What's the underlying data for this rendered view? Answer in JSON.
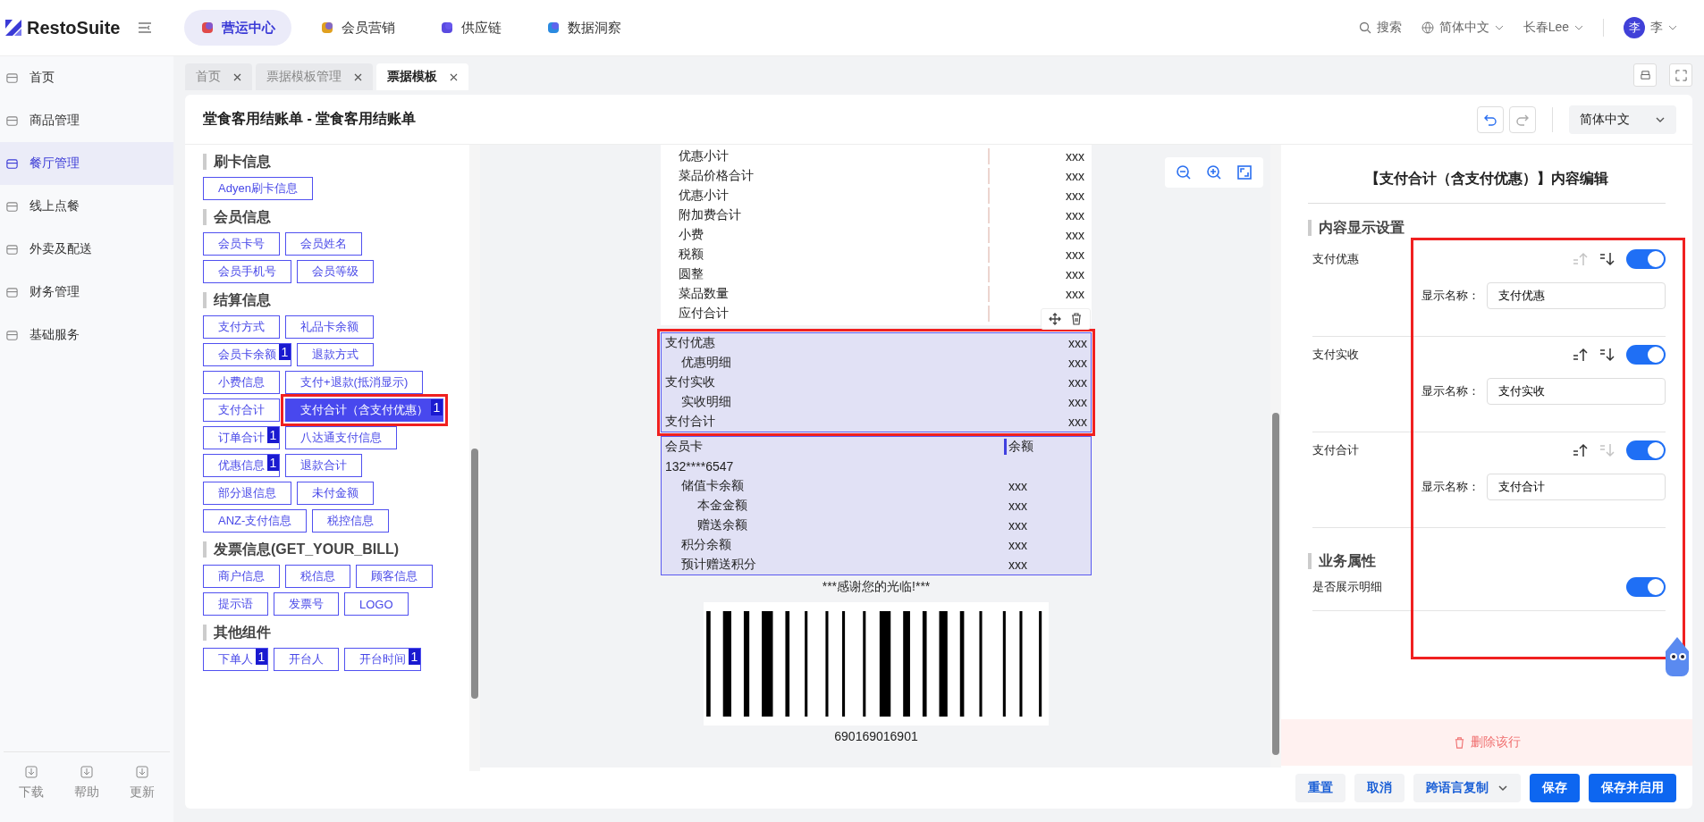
{
  "brand": {
    "name": "RestoSuite"
  },
  "top_nav": [
    {
      "label": "营运中心",
      "selected": true
    },
    {
      "label": "会员营销",
      "selected": false
    },
    {
      "label": "供应链",
      "selected": false
    },
    {
      "label": "数据洞察",
      "selected": false
    }
  ],
  "header_tools": {
    "search": "搜索",
    "language": "简体中文",
    "user": "长春Lee",
    "avatar": "李",
    "avatar_name": "李"
  },
  "sidebar": {
    "items": [
      {
        "label": "首页",
        "selected": false
      },
      {
        "label": "商品管理",
        "selected": false
      },
      {
        "label": "餐厅管理",
        "selected": true
      },
      {
        "label": "线上点餐",
        "selected": false
      },
      {
        "label": "外卖及配送",
        "selected": false
      },
      {
        "label": "财务管理",
        "selected": false
      },
      {
        "label": "基础服务",
        "selected": false
      }
    ],
    "footer": [
      {
        "label": "下载"
      },
      {
        "label": "帮助"
      },
      {
        "label": "更新"
      }
    ]
  },
  "tabs": [
    {
      "label": "首页",
      "selected": false
    },
    {
      "label": "票据模板管理",
      "selected": false
    },
    {
      "label": "票据模板",
      "selected": true
    }
  ],
  "page": {
    "title": "堂食客用结账单 - 堂食客用结账单",
    "language": "简体中文"
  },
  "components": {
    "sections": [
      {
        "title": "刷卡信息",
        "items": [
          {
            "label": "Adyen刷卡信息",
            "selected": false
          }
        ]
      },
      {
        "title": "会员信息",
        "items": [
          {
            "label": "会员卡号",
            "selected": false
          },
          {
            "label": "会员姓名",
            "selected": false
          },
          {
            "label": "会员手机号",
            "selected": false
          },
          {
            "label": "会员等级",
            "selected": false
          }
        ]
      },
      {
        "title": "结算信息",
        "items": [
          {
            "label": "支付方式",
            "selected": false
          },
          {
            "label": "礼品卡余额",
            "selected": false
          },
          {
            "label": "会员卡余额",
            "badge": "1",
            "selected": false
          },
          {
            "label": "退款方式",
            "selected": false
          },
          {
            "label": "小费信息",
            "selected": false
          },
          {
            "label": "支付+退款(抵消显示)",
            "selected": false
          },
          {
            "label": "支付合计",
            "selected": false
          },
          {
            "label": "支付合计（含支付优惠）",
            "badge": "1",
            "selected": true
          },
          {
            "label": "订单合计",
            "badge": "1",
            "selected": false
          },
          {
            "label": "八达通支付信息",
            "selected": false
          },
          {
            "label": "优惠信息",
            "badge": "1",
            "selected": false
          },
          {
            "label": "退款合计",
            "selected": false
          },
          {
            "label": "部分退信息",
            "selected": false
          },
          {
            "label": "未付金额",
            "selected": false
          },
          {
            "label": "ANZ-支付信息",
            "selected": false
          },
          {
            "label": "税控信息",
            "selected": false
          }
        ]
      },
      {
        "title": "发票信息(GET_YOUR_BILL)",
        "items": [
          {
            "label": "商户信息",
            "selected": false
          },
          {
            "label": "税信息",
            "selected": false
          },
          {
            "label": "顾客信息",
            "selected": false
          },
          {
            "label": "提示语",
            "selected": false
          },
          {
            "label": "发票号",
            "selected": false
          },
          {
            "label": "LOGO",
            "selected": false
          }
        ]
      },
      {
        "title": "其他组件",
        "items": [
          {
            "label": "下单人",
            "badge": "1",
            "selected": false
          },
          {
            "label": "开台人",
            "selected": false
          },
          {
            "label": "开台时间",
            "badge": "1",
            "selected": false
          }
        ]
      }
    ]
  },
  "receipt": {
    "blocks": [
      {
        "kind": "rows",
        "selected": false,
        "highlighted": false,
        "rows": [
          {
            "label": "优惠小计",
            "value": "xxx"
          },
          {
            "label": "菜品价格合计",
            "value": "xxx"
          },
          {
            "label": "优惠小计",
            "value": "xxx"
          },
          {
            "label": "附加费合计",
            "value": "xxx"
          },
          {
            "label": "小费",
            "value": "xxx"
          },
          {
            "label": "税额",
            "value": "xxx"
          },
          {
            "label": "圆整",
            "value": "xxx"
          },
          {
            "label": "菜品数量",
            "value": "xxx"
          },
          {
            "label": "应付合计"
          }
        ]
      },
      {
        "kind": "rows",
        "selected": true,
        "highlighted": true,
        "rows": [
          {
            "label": "支付优惠",
            "value": "xxx",
            "children": [
              {
                "label": "优惠明细",
                "value": "xxx"
              }
            ]
          },
          {
            "label": "支付实收",
            "value": "xxx",
            "children": [
              {
                "label": "实收明细",
                "value": "xxx"
              }
            ]
          },
          {
            "label": "支付合计",
            "value": "xxx"
          }
        ]
      },
      {
        "kind": "member",
        "selected": false,
        "highlighted": true,
        "header": {
          "label": "会员卡",
          "value": "余额"
        },
        "card_number": "132****6547",
        "rows": [
          {
            "label": "储值卡余额",
            "value": "xxx",
            "children": [
              {
                "label": "本金金额",
                "value": "xxx"
              },
              {
                "label": "赠送余额",
                "value": "xxx"
              }
            ]
          },
          {
            "label": "积分余额",
            "value": "xxx"
          },
          {
            "label": "预计赠送积分",
            "value": "xxx"
          }
        ]
      }
    ],
    "thanks": "***感谢您的光临!***",
    "barcode_number": "690169016901"
  },
  "editor": {
    "title": "【支付合计（含支付优惠）】内容编辑",
    "section_display": "内容显示设置",
    "annotation_frame": true,
    "fields": [
      {
        "name": "支付优惠",
        "up_enabled": false,
        "down_enabled": true,
        "on": true,
        "display_label": "显示名称：",
        "value": "支付优惠"
      },
      {
        "name": "支付实收",
        "up_enabled": true,
        "down_enabled": true,
        "on": true,
        "display_label": "显示名称：",
        "value": "支付实收"
      },
      {
        "name": "支付合计",
        "up_enabled": true,
        "down_enabled": false,
        "on": true,
        "display_label": "显示名称：",
        "value": "支付合计"
      }
    ],
    "section_business": "业务属性",
    "business": [
      {
        "name": "是否展示明细",
        "on": true
      }
    ],
    "delete_row": "删除该行"
  },
  "actions": [
    {
      "label": "重置",
      "kind": "plain"
    },
    {
      "label": "取消",
      "kind": "plain"
    },
    {
      "label": "跨语言复制",
      "kind": "dropdown"
    },
    {
      "label": "保存",
      "kind": "primary"
    },
    {
      "label": "保存并启用",
      "kind": "primary"
    }
  ]
}
